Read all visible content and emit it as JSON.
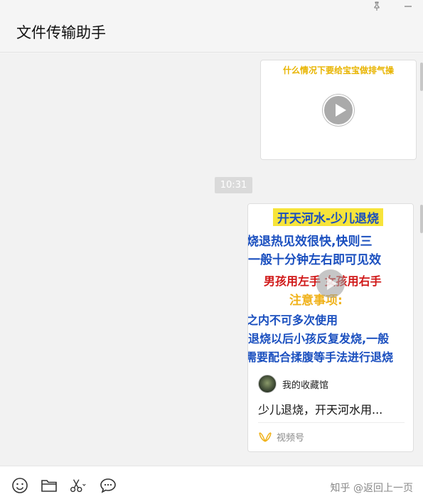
{
  "window": {
    "title": "文件传输助手",
    "pin_icon": "pin-icon",
    "minimize_icon": "minimize-icon"
  },
  "messages": {
    "video": {
      "caption": "什么情况下要给宝宝做排气操",
      "play_icon": "play-icon"
    },
    "timestamp": "10:31",
    "channel_card": {
      "cover_text": {
        "title": "开天河水-少儿退烧",
        "line1": "烧退热见效很快,快则三",
        "line2": "一般十分钟左右即可见效",
        "line3": "男孩用左手 女孩用右手",
        "line4": "注意事项:",
        "line5": "之内不可多次使用",
        "line6": "退烧以后小孩反复发烧,一般",
        "line7": "需要配合揉腹等手法进行退烧"
      },
      "author": "我的收藏馆",
      "description": "少儿退烧，开天河水用...",
      "channel_label": "视频号",
      "channel_icon": "channels-icon"
    }
  },
  "toolbar": {
    "emoji_icon": "emoji-icon",
    "folder_icon": "folder-icon",
    "scissors_icon": "scissors-icon",
    "chat_icon": "chat-bubble-icon",
    "watermark": "知乎 @返回上一页"
  }
}
